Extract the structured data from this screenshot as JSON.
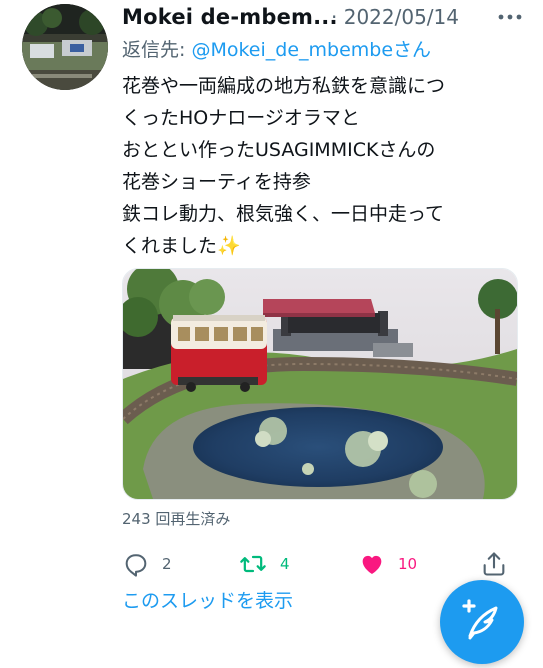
{
  "tweet": {
    "author_name": "Mokei de-mbem...",
    "separator": "·",
    "date": "2022/05/14",
    "reply_label": "返信先: ",
    "reply_handle": "@Mokei_de_mbembe",
    "reply_suffix": "さん",
    "body_lines": [
      "花巻や一両編成の地方私鉄を意識につ",
      "くったHOナロージオラマと",
      "おととい作ったUSAGIMMICKさんの",
      "花巻ショーティを持参",
      "鉄コレ動力、根気強く、一日中走って",
      "くれました"
    ],
    "emoji": "✨",
    "views_text": "243 回再生済み",
    "reply_count": "2",
    "retweet_count": "4",
    "like_count": "10",
    "thread_link": "このスレッドを表示"
  },
  "icons": {
    "more": "more-horizontal-icon",
    "reply": "reply-icon",
    "retweet": "retweet-icon",
    "like": "heart-filled-icon",
    "share": "share-icon",
    "compose": "compose-feather-icon"
  },
  "colors": {
    "text": "#0f1419",
    "muted": "#536471",
    "link": "#1d9bf0",
    "retweet": "#00ba7c",
    "like": "#f91880",
    "fab": "#1d9bf0"
  }
}
